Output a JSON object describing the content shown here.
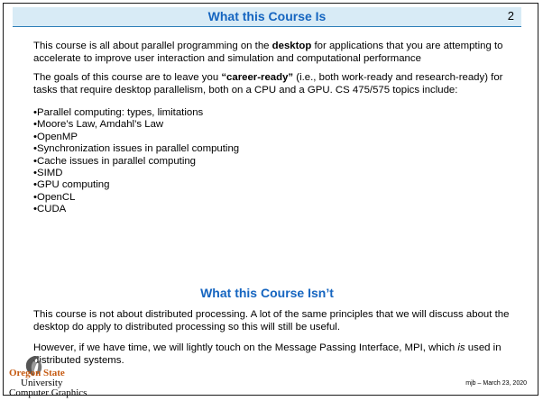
{
  "slide": {
    "page_number": "2",
    "title": "What this Course Is",
    "is": {
      "intro": {
        "before": "This course is all about parallel programming on the ",
        "bold": "desktop",
        "after": " for applications that you are attempting to accelerate to improve user interaction and simulation and computational performance"
      },
      "goals": {
        "before": "The goals of this course are to leave you ",
        "bold": "“career-ready”",
        "after": " (i.e., both work-ready and research-ready) for tasks that require desktop parallelism, both on a CPU and a GPU. CS 475/575 topics include:"
      },
      "topics": [
        "Parallel computing: types, limitations",
        "Moore’s Law, Amdahl’s Law",
        "OpenMP",
        "Synchronization issues in parallel computing",
        "Cache issues in parallel computing",
        "SIMD",
        "GPU computing",
        "OpenCL",
        "CUDA"
      ]
    },
    "isnt": {
      "title": "What this Course Isn’t",
      "para1": "This course is not about distributed processing. A lot of the same principles that we will discuss about the desktop do apply to distributed processing so this will still be useful.",
      "para2": {
        "before": "However, if we have time, we will lightly touch on the Message Passing Interface, MPI, which ",
        "italic": "is",
        "after": " used in distributed systems."
      }
    },
    "logo": {
      "line1": "Oregon State",
      "line2": "University",
      "line3": "Computer Graphics",
      "accent_color": "#c55a11"
    },
    "footer": "mjb – March 23, 2020",
    "colors": {
      "heading": "#1565c0",
      "title_bar": "#d8ebf6"
    }
  }
}
